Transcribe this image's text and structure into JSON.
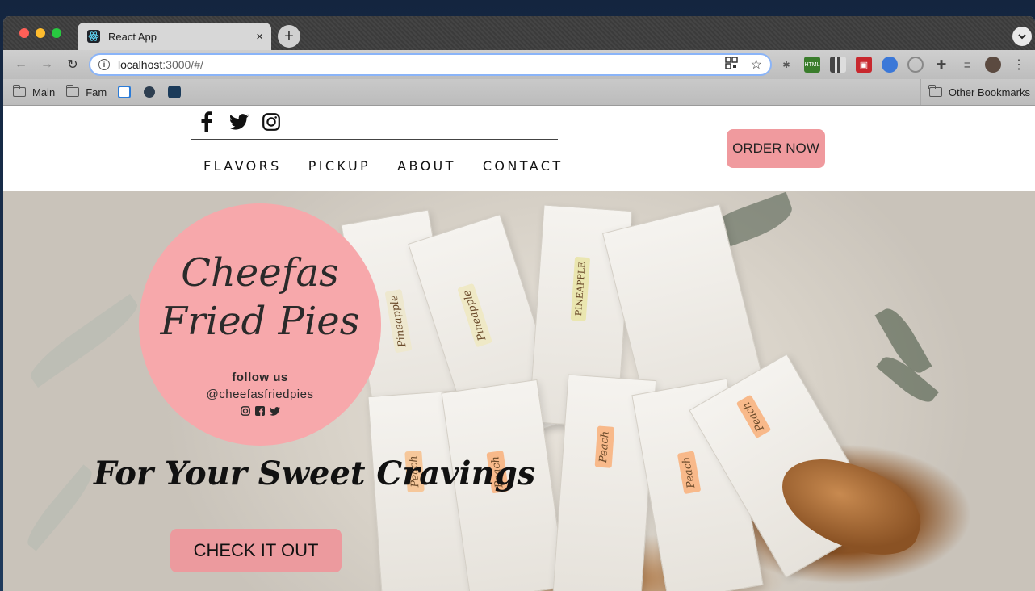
{
  "browser": {
    "tab_title": "React App",
    "tab_close": "×",
    "new_tab": "+",
    "url_host": "localhost",
    "url_rest": ":3000/#/",
    "bookmarks": [
      {
        "label": "Main",
        "icon": "folder-icon"
      },
      {
        "label": "Fam",
        "icon": "folder-icon"
      }
    ],
    "other_bookmarks": "Other Bookmarks"
  },
  "header": {
    "socials": [
      "facebook-icon",
      "twitter-icon",
      "instagram-icon"
    ],
    "nav": [
      "FLAVORS",
      "PICKUP",
      "ABOUT",
      "CONTACT"
    ],
    "order_button": "ORDER NOW"
  },
  "hero": {
    "logo_line1": "Cheefas",
    "logo_line2": "Fried Pies",
    "follow": "follow us",
    "handle": "@cheefasfriedpies",
    "logo_socials": [
      "instagram-icon",
      "facebook-icon",
      "twitter-icon"
    ],
    "tagline": "For Your Sweet Cravings",
    "cta_button": "CHECK IT OUT",
    "pack_labels": [
      "Pineapple",
      "Pineapple",
      "PINEAPPLE",
      "Peach",
      "Peach",
      "Peach",
      "Peach",
      "Peach"
    ]
  },
  "colors": {
    "brand_pink": "#f7a8ab",
    "button_pink": "#f09a9e"
  }
}
